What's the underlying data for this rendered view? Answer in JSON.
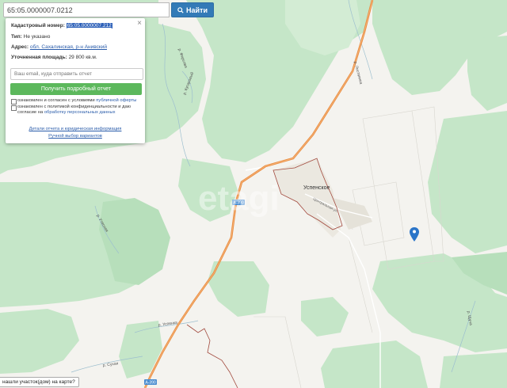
{
  "search": {
    "value": "65:05.0000007.0212",
    "button_label": "Найти"
  },
  "panel": {
    "cadastral_label": "Кадастровый номер:",
    "cadastral_value": "65:05.0000007.212",
    "type_label": "Тип:",
    "type_value": "Не указано",
    "address_label": "Адрес:",
    "address_value": "обл. Сахалинская, р-н Анивский",
    "area_label": "Уточненная площадь:",
    "area_value": "29 800 кв.м.",
    "email_placeholder": "Ваш email, куда отправить отчет",
    "get_report_label": "Получить подробный отчет",
    "consent1_text": "ознакомлен и согласен с условиями",
    "consent1_link": "публичной оферты",
    "consent2_text": "ознакомлен с политикой конфиденциальности и даю согласие на",
    "consent2_link": "обработку персональных данных",
    "details_link": "Детали отчета и юридическая информация",
    "manual_link": "Ручной выбор вариантов"
  },
  "map": {
    "settlement_label": "Успенское",
    "street_label": "Центральная ул.",
    "road_shield_1": "А-390",
    "road_shield_2": "А-390",
    "watermark": "etagi",
    "river_labels": [
      "р. Фирсова",
      "р. Листвянка",
      "р. Кугаровый",
      "р. Утесная",
      "р. Успенка",
      "р. Сухая",
      "р. Щуча"
    ],
    "colors": {
      "forest": "#c5e6c8",
      "field": "#f4f3ef",
      "road": "#e8893a",
      "boundary": "#a24a3e",
      "marker": "#2b75c8"
    }
  },
  "bottom": {
    "label": "нашли участок(дом) на карте?"
  }
}
